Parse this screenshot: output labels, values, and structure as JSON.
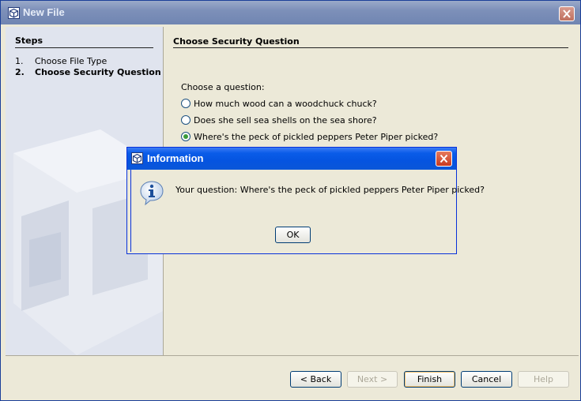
{
  "window": {
    "title": "New File",
    "close_icon": "close-icon"
  },
  "steps": {
    "heading": "Steps",
    "items": [
      {
        "num": "1.",
        "label": "Choose File Type",
        "current": false
      },
      {
        "num": "2.",
        "label": "Choose Security Question",
        "current": true
      }
    ]
  },
  "panel": {
    "title": "Choose Security Question",
    "prompt": "Choose a question:",
    "options": [
      {
        "label": "How much wood can a woodchuck chuck?",
        "selected": false
      },
      {
        "label": "Does she sell sea shells on the sea shore?",
        "selected": false
      },
      {
        "label": "Where's the peck of pickled peppers Peter Piper picked?",
        "selected": true
      }
    ]
  },
  "footer": {
    "back_label": "< Back",
    "next_label": "Next >",
    "finish_label": "Finish",
    "cancel_label": "Cancel",
    "help_label": "Help"
  },
  "dialog": {
    "title": "Information",
    "message": "Your question: Where's the peck of pickled peppers Peter Piper picked?",
    "ok_label": "OK",
    "icon": "info-icon"
  },
  "colors": {
    "dialog_title_blue": "#0554e0",
    "inactive_title": "#7d90b9",
    "face": "#ece9d8"
  }
}
